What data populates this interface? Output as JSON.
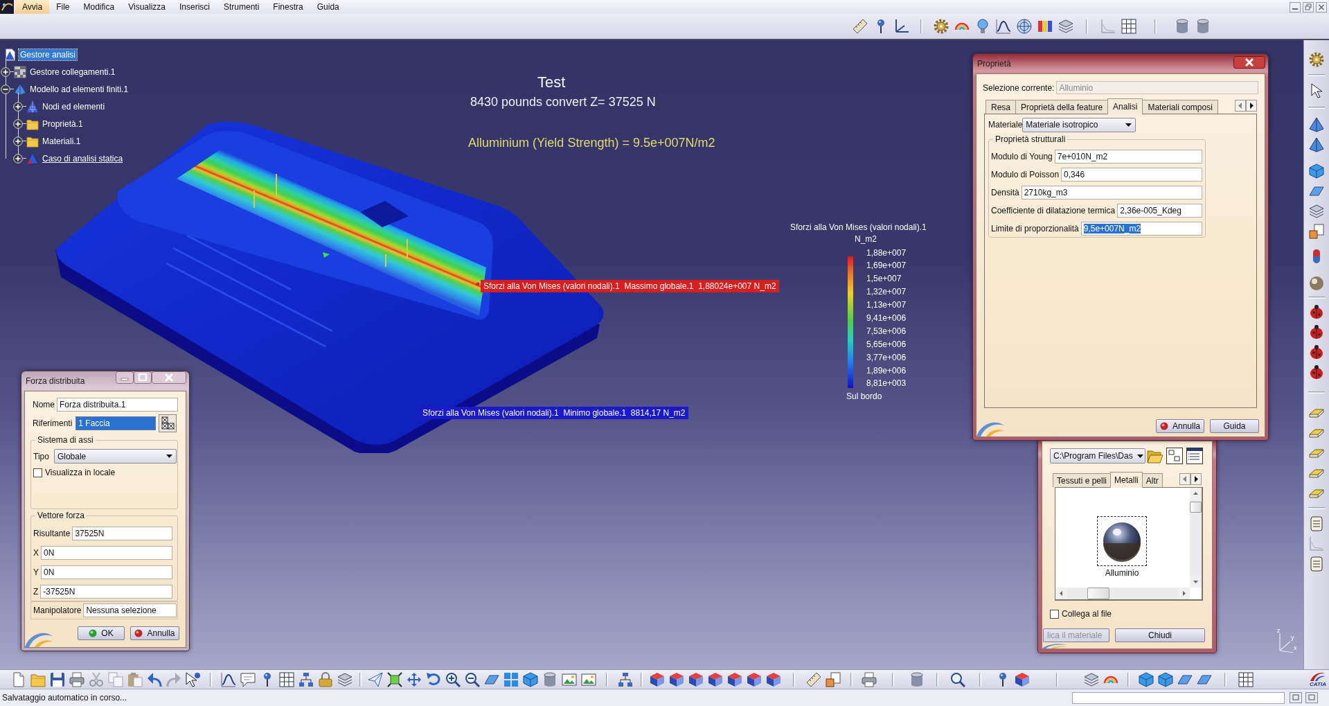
{
  "menu_bar": {
    "items": [
      {
        "label": "Avvia",
        "selected": true
      },
      {
        "label": "File",
        "selected": false
      },
      {
        "label": "Modifica",
        "selected": false
      },
      {
        "label": "Visualizza",
        "selected": false
      },
      {
        "label": "Inserisci",
        "selected": false
      },
      {
        "label": "Strumenti",
        "selected": false
      },
      {
        "label": "Finestra",
        "selected": false
      },
      {
        "label": "Guida",
        "selected": false
      }
    ]
  },
  "spec_tree": {
    "items": [
      {
        "label": "Gestore analisi",
        "kind": "analysis",
        "selected": true,
        "current": false,
        "children": [
          {
            "label": "Gestore collegamenti.1",
            "kind": "connections",
            "selected": false,
            "current": false,
            "expanded": false
          },
          {
            "label": "Modello ad elementi finiti.1",
            "kind": "model",
            "selected": false,
            "current": false,
            "expanded": true,
            "children": [
              {
                "label": "Nodi ed elementi",
                "kind": "mesh",
                "selected": false,
                "current": false,
                "expanded": false
              },
              {
                "label": "Proprietà.1",
                "kind": "folder",
                "selected": false,
                "current": false,
                "expanded": false
              },
              {
                "label": "Materiali.1",
                "kind": "folder",
                "selected": false,
                "current": false,
                "expanded": false
              },
              {
                "label": "Caso di analisi statica",
                "kind": "case",
                "selected": false,
                "current": true,
                "expanded": false
              }
            ]
          }
        ]
      }
    ]
  },
  "viewport": {
    "annotations": [
      {
        "kind": "title",
        "text": "Test"
      },
      {
        "kind": "subtitle",
        "text": "8430 pounds convert Z= 37525 N"
      },
      {
        "kind": "note",
        "text": "Alluminium (Yield Strength) = 9.5e+007N/m2"
      }
    ],
    "extreme_labels": [
      {
        "kind": "max",
        "text": "Sforzi alla Von Mises (valori nodali).1  Massimo globale.1  1,88024e+007 N_m2"
      },
      {
        "kind": "min",
        "text": "Sforzi alla Von Mises (valori nodali).1  Minimo globale.1  8814,17 N_m2"
      }
    ],
    "legend": {
      "title": "Sforzi alla Von Mises (valori nodali).1",
      "unit": "N_m2",
      "values": [
        "1,88e+007",
        "1,69e+007",
        "1,5e+007",
        "1,32e+007",
        "1,13e+007",
        "9,41e+006",
        "7,53e+006",
        "5,65e+006",
        "3,77e+006",
        "1,89e+006",
        "8,81e+003"
      ],
      "footer": "Sul bordo"
    },
    "axis_labels": [
      "z",
      "y",
      "x"
    ]
  },
  "force_dialog": {
    "title": "Forza distribuita",
    "active": false,
    "rows": [
      {
        "kind": "text",
        "label": "Nome",
        "value": "Forza distribuita.1",
        "highlighted": false
      },
      {
        "kind": "selection",
        "label": "Riferimenti",
        "value": "1 Faccia",
        "highlighted": true
      }
    ],
    "axis_group": {
      "title": "Sistema di assi",
      "type_label": "Tipo",
      "type_value": "Globale",
      "checkbox": {
        "label": "Visualizza in locale",
        "checked": false
      }
    },
    "force_group": {
      "title": "Vettore forza",
      "fields": [
        {
          "label": "Risultante",
          "value": "37525N"
        },
        {
          "label": "X",
          "value": "0N"
        },
        {
          "label": "Y",
          "value": "0N"
        },
        {
          "label": "Z",
          "value": "-37525N"
        }
      ]
    },
    "manipulator": {
      "label": "Manipolatore",
      "value": "Nessuna selezione"
    },
    "buttons": [
      {
        "label": "OK",
        "kind": "ok"
      },
      {
        "label": "Annulla",
        "kind": "cancel"
      }
    ]
  },
  "properties_dialog": {
    "title": "Proprietà",
    "active": true,
    "current_selection": {
      "label": "Selezione corrente:",
      "value": "Alluminio",
      "disabled": true
    },
    "tabs": [
      {
        "label": "Resa",
        "selected": false
      },
      {
        "label": "Proprietà della feature",
        "selected": false
      },
      {
        "label": "Analisi",
        "selected": true
      },
      {
        "label": "Materiali composi",
        "selected": false
      }
    ],
    "material": {
      "label": "Materiale",
      "value": "Materiale isotropico"
    },
    "group_title": "Proprietà strutturali",
    "fields": [
      {
        "label": "Modulo di Young",
        "value": "7e+010N_m2",
        "highlighted": false
      },
      {
        "label": "Modulo di Poisson",
        "value": "0,346",
        "highlighted": false
      },
      {
        "label": "Densità",
        "value": "2710kg_m3",
        "highlighted": false
      },
      {
        "label": "Coefficiente di dilatazione termica",
        "value": "2,36e-005_Kdeg",
        "highlighted": false
      },
      {
        "label": "Limite di proporzionalità",
        "value": "9,5e+007N_m2",
        "highlighted": true
      }
    ],
    "buttons": [
      {
        "label": "Annulla",
        "kind": "cancel"
      },
      {
        "label": "Guida",
        "kind": "help"
      }
    ]
  },
  "material_library": {
    "active": true,
    "path": "C:\\Program Files\\Das",
    "tabs": [
      {
        "label": "Tessuti e pelli",
        "selected": false
      },
      {
        "label": "Metalli",
        "selected": true
      },
      {
        "label": "Altr",
        "selected": false
      }
    ],
    "items": [
      {
        "label": "Alluminio",
        "selected": true
      }
    ],
    "checkbox": {
      "label": "Collega al file",
      "checked": false
    },
    "buttons": [
      {
        "label": "lica il materiale",
        "disabled": true
      },
      {
        "label": "Chiudi",
        "disabled": false
      }
    ]
  },
  "bottom_toolbar": {
    "logo": "CATIA"
  },
  "status_bar": {
    "message": "Salvataggio automatico in corso..."
  }
}
